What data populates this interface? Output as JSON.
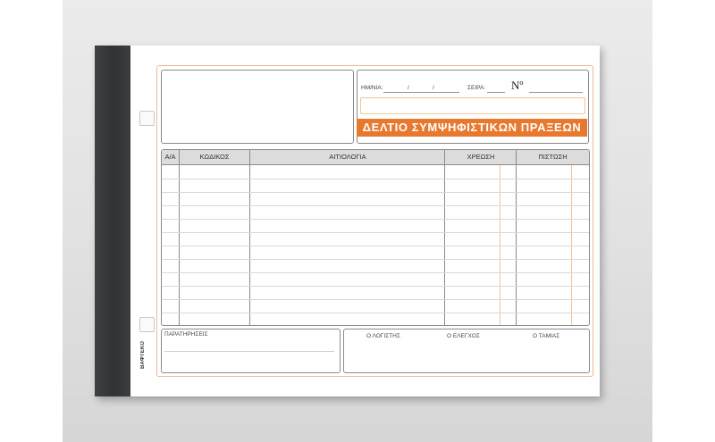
{
  "document": {
    "title": "ΔΕΛΤΙΟ ΣΥΜΨΗΦΙΣΤΙΚΩΝ ΠΡΑΞΕΩΝ",
    "date_label": "ΗΜ/ΝΙΑ:",
    "date_sep_1": "/",
    "date_sep_2": "/",
    "series_label": "ΣΕΙΡΑ:",
    "number_label": "Nº",
    "brand": "ΒΑΦΤΕΚΟ",
    "accent_color": "#e8782e"
  },
  "table": {
    "headers": [
      "Α/Α",
      "ΚΩΔΙΚΟΣ",
      "ΑΙΤΙΟΛΟΓΙΑ",
      "ΧΡΕΩΣΗ",
      "ΠΙΣΤΩΣΗ"
    ]
  },
  "footer": {
    "remarks_label": "ΠΑΡΑΤΗΡΗΣΕΙΣ",
    "accountant_label": "Ο ΛΟΓΙΣΤΗΣ",
    "auditor_label": "Ο ΕΛΕΓΧΟΣ",
    "cashier_label": "Ο ΤΑΜΙΑΣ"
  }
}
